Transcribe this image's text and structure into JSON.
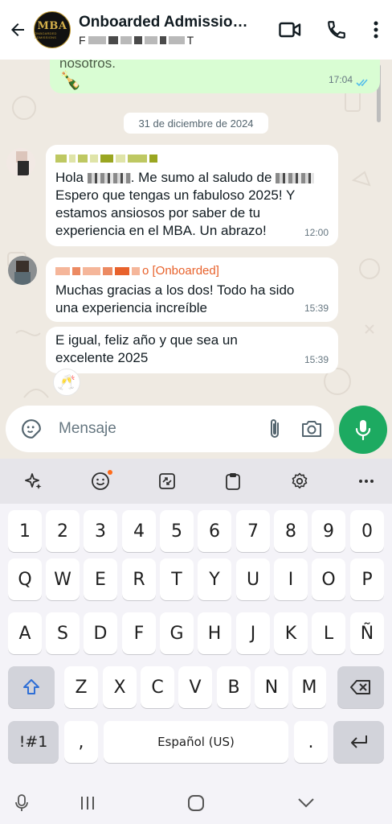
{
  "header": {
    "title": "Onboarded Admissions...",
    "subtitle_initial": "F",
    "subtitle_final": "T",
    "avatar_logo": "MBA",
    "avatar_sub": "ONBOARDED ADMISSIONS"
  },
  "chat": {
    "prev_message": {
      "text": "nosotros.",
      "emoji": "🍾",
      "time": "17:04",
      "status": "read"
    },
    "date_chip": "31 de diciembre de 2024",
    "messages": [
      {
        "sender_color": "#9aa621",
        "text_part1": "Hola",
        "text_part2": ". Me sumo al saludo de",
        "text_part3": "Espero que tengas un fabuloso 2025! Y estamos ansiosos por saber de tu experiencia en el MBA. Un abrazo!",
        "time": "12:00"
      },
      {
        "sender_suffix": "o [Onboarded]",
        "sender_color": "#e8622c",
        "text": "Muchas gracias a los dos! Todo ha sido una experiencia increíble",
        "time": "15:39"
      },
      {
        "text": "E igual, feliz año y que sea un excelente 2025",
        "time": "15:39",
        "reaction": "🥂"
      }
    ]
  },
  "composer": {
    "placeholder": "Mensaje",
    "send_color": "#1daa61"
  },
  "keyboard": {
    "toolbar_icons": [
      "sparkle-icon",
      "emoji-icon",
      "clipboard-translate-icon",
      "clipboard-icon",
      "settings-icon",
      "more-icon"
    ],
    "row_numbers": [
      "1",
      "2",
      "3",
      "4",
      "5",
      "6",
      "7",
      "8",
      "9",
      "0"
    ],
    "row1": [
      "Q",
      "W",
      "E",
      "R",
      "T",
      "Y",
      "U",
      "I",
      "O",
      "P"
    ],
    "row2": [
      "A",
      "S",
      "D",
      "F",
      "G",
      "H",
      "J",
      "K",
      "L",
      "Ñ"
    ],
    "row3": [
      "Z",
      "X",
      "C",
      "V",
      "B",
      "N",
      "M"
    ],
    "symbols_label": "!#1",
    "comma": ",",
    "space_label": "Español (US)",
    "period": "."
  }
}
